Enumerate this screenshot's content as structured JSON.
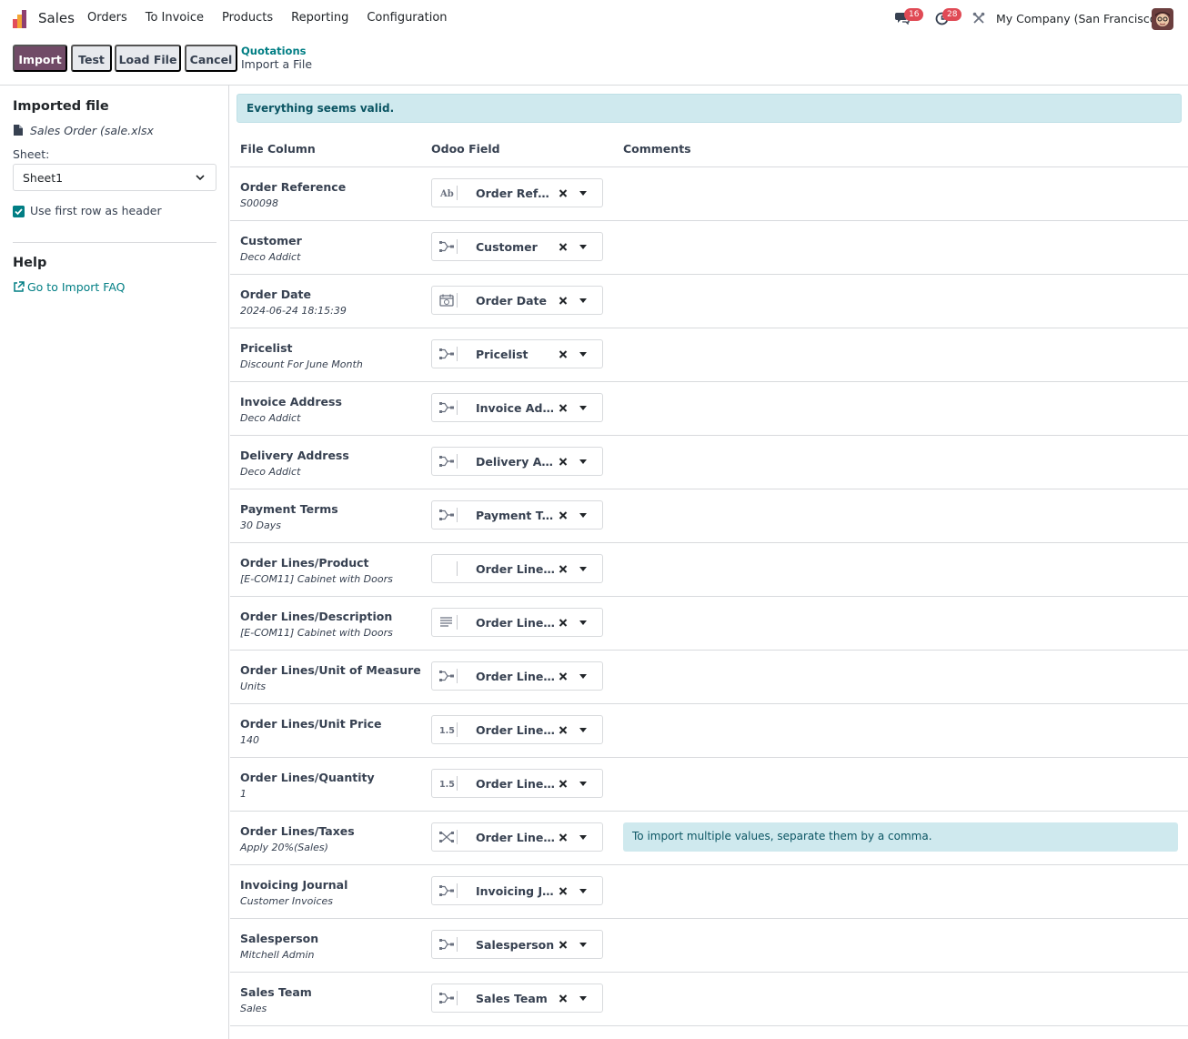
{
  "navbar": {
    "app_name": "Sales",
    "menu": [
      "Orders",
      "To Invoice",
      "Products",
      "Reporting",
      "Configuration"
    ],
    "chat_count": "16",
    "activity_count": "28",
    "company": "My Company (San Francisco)"
  },
  "control": {
    "import_label": "Import",
    "test_label": "Test",
    "load_label": "Load File",
    "cancel_label": "Cancel",
    "breadcrumb_parent": "Quotations",
    "breadcrumb_current": "Import a File"
  },
  "sidebar": {
    "imported_title": "Imported file",
    "file_name": "Sales Order (sale.xlsx",
    "sheet_label": "Sheet:",
    "sheet_value": "Sheet1",
    "header_checkbox_label": "Use first row as header",
    "header_checked": true,
    "help_title": "Help",
    "faq_link": "Go to Import FAQ"
  },
  "main": {
    "status": "Everything seems valid.",
    "headers": {
      "file_column": "File Column",
      "odoo_field": "Odoo Field",
      "comments": "Comments"
    },
    "rows": [
      {
        "name": "Order Reference",
        "sample": "S00098",
        "field": "Order Reference",
        "icon": "text-icon",
        "comment": ""
      },
      {
        "name": "Customer",
        "sample": "Deco Addict",
        "field": "Customer",
        "icon": "relation-icon",
        "comment": ""
      },
      {
        "name": "Order Date",
        "sample": "2024-06-24 18:15:39",
        "field": "Order Date",
        "icon": "calendar-icon",
        "comment": ""
      },
      {
        "name": "Pricelist",
        "sample": "Discount For June Month",
        "field": "Pricelist",
        "icon": "relation-icon",
        "comment": ""
      },
      {
        "name": "Invoice Address",
        "sample": "Deco Addict",
        "field": "Invoice Address",
        "icon": "relation-icon",
        "comment": ""
      },
      {
        "name": "Delivery Address",
        "sample": "Deco Addict",
        "field": "Delivery Address",
        "icon": "relation-icon",
        "comment": ""
      },
      {
        "name": "Payment Terms",
        "sample": "30 Days",
        "field": "Payment Terms",
        "icon": "relation-icon",
        "comment": ""
      },
      {
        "name": "Order Lines/Product",
        "sample": "[E-COM11] Cabinet with Doors",
        "field": "Order Lines / Product",
        "icon": "none",
        "comment": ""
      },
      {
        "name": "Order Lines/Description",
        "sample": "[E-COM11] Cabinet with Doors",
        "field": "Order Lines / Description",
        "icon": "textarea-icon",
        "comment": ""
      },
      {
        "name": "Order Lines/Unit of Measure",
        "sample": "Units",
        "field": "Order Lines / Unit of Measure",
        "icon": "relation-icon",
        "comment": ""
      },
      {
        "name": "Order Lines/Unit Price",
        "sample": "140",
        "field": "Order Lines / Unit Price",
        "icon": "number-icon",
        "comment": ""
      },
      {
        "name": "Order Lines/Quantity",
        "sample": "1",
        "field": "Order Lines / Quantity",
        "icon": "number-icon",
        "comment": ""
      },
      {
        "name": "Order Lines/Taxes",
        "sample": "Apply 20%(Sales)",
        "field": "Order Lines / Taxes",
        "icon": "many2many-icon",
        "comment": "To import multiple values, separate them by a comma."
      },
      {
        "name": "Invoicing Journal",
        "sample": "Customer Invoices",
        "field": "Invoicing Journal",
        "icon": "relation-icon",
        "comment": ""
      },
      {
        "name": "Salesperson",
        "sample": "Mitchell Admin",
        "field": "Salesperson",
        "icon": "relation-icon",
        "comment": ""
      },
      {
        "name": "Sales Team",
        "sample": "Sales",
        "field": "Sales Team",
        "icon": "relation-icon",
        "comment": ""
      }
    ]
  },
  "colors": {
    "primary": "#714b67",
    "link": "#017e84",
    "info_bg": "#cfe9ee",
    "badge": "#e04a55"
  }
}
